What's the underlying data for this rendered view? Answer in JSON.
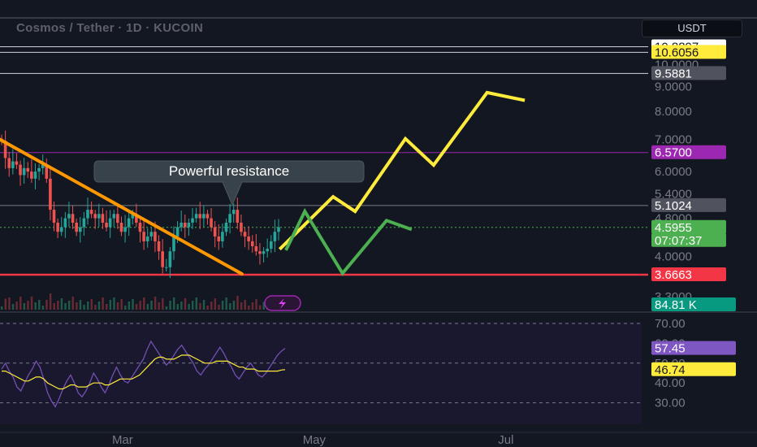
{
  "header": {
    "title": "Cosmos / Tether · 1D · KUCOIN",
    "currency": "USDT"
  },
  "annotation": {
    "label": "Powerful resistance"
  },
  "chart_data": [
    {
      "type": "candlestick",
      "title": "Cosmos / Tether · 1D · KUCOIN",
      "scale": "log",
      "y_ticks": [
        "10.0000",
        "9.0000",
        "8.0000",
        "7.0000",
        "6.0000",
        "5.4000",
        "4.8000",
        "4.0000",
        "3.3000"
      ],
      "x_ticks": [
        "Mar",
        "May",
        "Jul"
      ],
      "price_badges": [
        {
          "value": "10.8897",
          "color": "#ffffff",
          "text_color": "#131722"
        },
        {
          "value": "10.6056",
          "color": "#ffeb3b",
          "text_color": "#131722"
        },
        {
          "value": "9.5881",
          "color": "#50535e",
          "text_color": "#ffffff"
        },
        {
          "value": "6.5700",
          "color": "#9c27b0",
          "text_color": "#ffffff"
        },
        {
          "value": "5.1024",
          "color": "#50535e",
          "text_color": "#ffffff"
        },
        {
          "value": "4.5955",
          "color": "#4caf50",
          "text_color": "#ffffff"
        },
        {
          "value": "07:07:37",
          "color": "#4caf50",
          "text_color": "#ffffff"
        },
        {
          "value": "3.6663",
          "color": "#f23645",
          "text_color": "#ffffff"
        }
      ],
      "horizontal_levels": [
        {
          "price": 10.8897,
          "color": "#d1d4dc"
        },
        {
          "price": 10.6056,
          "color": "#d1d4dc"
        },
        {
          "price": 9.5881,
          "color": "#d1d4dc"
        },
        {
          "price": 6.57,
          "color": "#9c27b0"
        },
        {
          "price": 5.1024,
          "color": "#787b86"
        },
        {
          "price": 4.5955,
          "color": "#4caf50",
          "style": "dotted"
        },
        {
          "price": 3.6663,
          "color": "#f23645"
        }
      ],
      "trendline": {
        "color": "#ff9800",
        "from": {
          "date": "Jan-20",
          "price": 7.05
        },
        "to": {
          "date": "Apr-08",
          "price": 3.68
        }
      },
      "forecast_paths": [
        {
          "name": "bullish",
          "color": "#ffeb3b",
          "points": [
            [
              4.14,
              "Apr-20"
            ],
            [
              5.32,
              "May-07"
            ],
            [
              4.96,
              "May-14"
            ],
            [
              7.02,
              "May-30"
            ],
            [
              6.19,
              "Jun-08"
            ],
            [
              8.75,
              "Jun-25"
            ],
            [
              8.43,
              "Jul-07"
            ]
          ]
        },
        {
          "name": "alternative",
          "color": "#4caf50",
          "points": [
            [
              4.12,
              "Apr-22"
            ],
            [
              4.96,
              "Apr-28"
            ],
            [
              3.69,
              "May-10"
            ],
            [
              4.75,
              "May-24"
            ],
            [
              4.55,
              "Jun-01"
            ]
          ]
        }
      ],
      "price_path": [
        6.95,
        6.4,
        6.1,
        6.3,
        6.2,
        5.9,
        6.1,
        6.0,
        5.8,
        6.0,
        6.1,
        6.2,
        5.8,
        5.0,
        4.7,
        4.5,
        4.6,
        4.8,
        4.9,
        4.7,
        4.5,
        4.6,
        4.8,
        5.0,
        4.9,
        4.8,
        4.9,
        4.7,
        4.6,
        4.8,
        4.9,
        4.7,
        4.5,
        4.6,
        4.8,
        4.9,
        4.7,
        4.5,
        4.3,
        4.4,
        4.5,
        4.3,
        4.1,
        3.8,
        3.8,
        4.1,
        4.4,
        4.6,
        4.7,
        4.6,
        4.7,
        4.8,
        4.9,
        4.8,
        4.9,
        4.8,
        4.6,
        4.4,
        4.3,
        4.5,
        4.7,
        4.9,
        5.0,
        4.7,
        4.5,
        4.4,
        4.3,
        4.2,
        4.1,
        4.05,
        4.1,
        4.15,
        4.3,
        4.5,
        4.6
      ],
      "volume_badge": {
        "value": "84.81 K",
        "color": "#089981"
      }
    },
    {
      "type": "line",
      "name": "RSI",
      "y_ticks": [
        "70.00",
        "60.00",
        "50.00",
        "40.00",
        "30.00"
      ],
      "ylim": [
        25,
        75
      ],
      "series": [
        {
          "color": "#7e57c2",
          "values": [
            47,
            50,
            46,
            43,
            38,
            36,
            40,
            44,
            47,
            51,
            48,
            42,
            35,
            31,
            28,
            32,
            37,
            41,
            44,
            40,
            35,
            33,
            36,
            40,
            45,
            42,
            38,
            35,
            39,
            44,
            48,
            44,
            41,
            40,
            43,
            46,
            49,
            52,
            57,
            61,
            58,
            55,
            52,
            49,
            51,
            54,
            57,
            59,
            56,
            53,
            50,
            46,
            44,
            47,
            49,
            52,
            55,
            58,
            55,
            51,
            48,
            44,
            42,
            45,
            48,
            50,
            47,
            44,
            43,
            45,
            48,
            51,
            54,
            56,
            57.45
          ]
        },
        {
          "color": "#ffeb3b",
          "values": [
            46,
            46,
            45,
            44,
            43,
            42,
            41,
            41,
            42,
            43,
            43,
            42,
            40,
            39,
            38,
            37,
            37,
            38,
            39,
            39,
            38,
            38,
            38,
            39,
            40,
            40,
            40,
            39,
            39,
            40,
            41,
            42,
            42,
            42,
            42,
            43,
            44,
            46,
            48,
            50,
            52,
            53,
            53,
            52,
            52,
            52,
            53,
            54,
            54,
            54,
            53,
            52,
            51,
            50,
            50,
            50,
            51,
            51,
            51,
            51,
            50,
            49,
            48,
            48,
            47,
            47,
            47,
            46,
            46,
            46,
            46,
            46,
            46,
            46.5,
            46.74
          ]
        }
      ],
      "value_badges": [
        {
          "value": "57.45",
          "color": "#7e57c2",
          "text_color": "#ffffff"
        },
        {
          "value": "46.74",
          "color": "#ffeb3b",
          "text_color": "#131722"
        }
      ]
    }
  ]
}
